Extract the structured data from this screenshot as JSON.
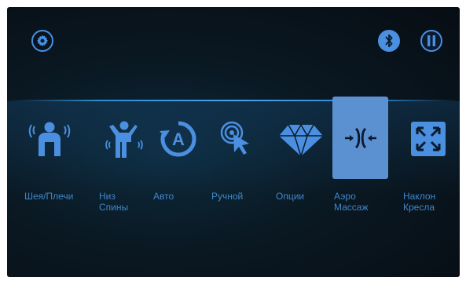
{
  "header": {
    "settings_icon": "gear-icon",
    "bluetooth_icon": "bluetooth-icon",
    "pause_icon": "pause-icon"
  },
  "colors": {
    "accent": "#4b8fe0",
    "label": "#3f86c9",
    "selected_tile": "#5b90d1",
    "background": "#08121a"
  },
  "menu": {
    "items": [
      {
        "label": "Шея/Плечи",
        "icon": "neck-shoulders-icon"
      },
      {
        "label": "Низ\nСпины",
        "icon": "lower-back-icon"
      },
      {
        "label": "Авто",
        "icon": "auto-icon"
      },
      {
        "label": "Ручной",
        "icon": "manual-pointer-icon"
      },
      {
        "label": "Опции",
        "icon": "diamond-icon"
      },
      {
        "label": "Аэро\nМассаж",
        "icon": "air-massage-icon",
        "selected": true
      },
      {
        "label": "Наклон\nКресла",
        "icon": "recline-expand-icon"
      }
    ]
  }
}
